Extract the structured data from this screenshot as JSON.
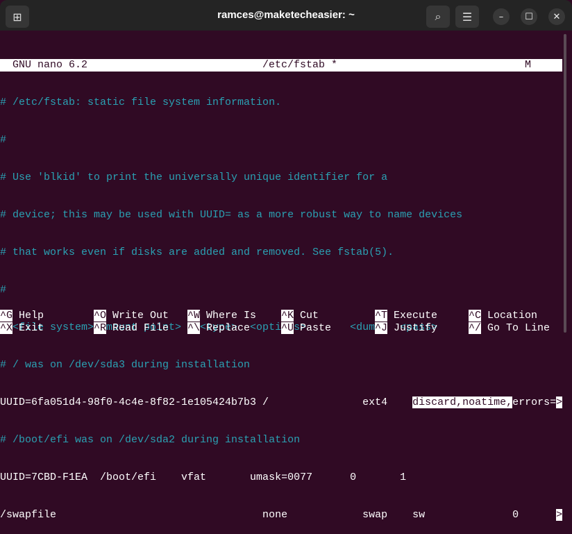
{
  "window": {
    "title": "ramces@maketecheasier: ~"
  },
  "header_buttons": {
    "new_tab": "⊞",
    "search": "⌕",
    "menu": "☰",
    "minimize": "–",
    "maximize": "☐",
    "close": "✕"
  },
  "nano": {
    "version": "GNU nano 6.2",
    "filename": "/etc/fstab *",
    "modified": "M"
  },
  "lines": [
    "# /etc/fstab: static file system information.",
    "#",
    "# Use 'blkid' to print the universally unique identifier for a",
    "# device; this may be used with UUID= as a more robust way to name devices",
    "# that works even if disks are added and removed. See fstab(5).",
    "#",
    "# <file system> <mount point>   <type>  <options>       <dump>  <pass>",
    "# / was on /dev/sda3 during installation"
  ],
  "root_line": {
    "prefix": "UUID=6fa051d4-98f0-4c4e-8f82-1e105424b7b3 /               ext4    ",
    "selected": "discard,noatime,",
    "rest": "errors=",
    "overflow": ">"
  },
  "efi_comment": "# /boot/efi was on /dev/sda2 during installation",
  "efi_line": "UUID=7CBD-F1EA  /boot/efi    vfat       umask=0077      0       1",
  "swap_line": {
    "text": "/swapfile                                 none            swap    sw              0      ",
    "overflow": ">"
  },
  "shortcuts": [
    {
      "key": "^G",
      "label": "Help"
    },
    {
      "key": "^X",
      "label": "Exit"
    },
    {
      "key": "^O",
      "label": "Write Out"
    },
    {
      "key": "^R",
      "label": "Read File"
    },
    {
      "key": "^W",
      "label": "Where Is"
    },
    {
      "key": "^\\",
      "label": "Replace"
    },
    {
      "key": "^K",
      "label": "Cut"
    },
    {
      "key": "^U",
      "label": "Paste"
    },
    {
      "key": "^T",
      "label": "Execute"
    },
    {
      "key": "^J",
      "label": "Justify"
    },
    {
      "key": "^C",
      "label": "Location"
    },
    {
      "key": "^/",
      "label": "Go To Line"
    }
  ]
}
